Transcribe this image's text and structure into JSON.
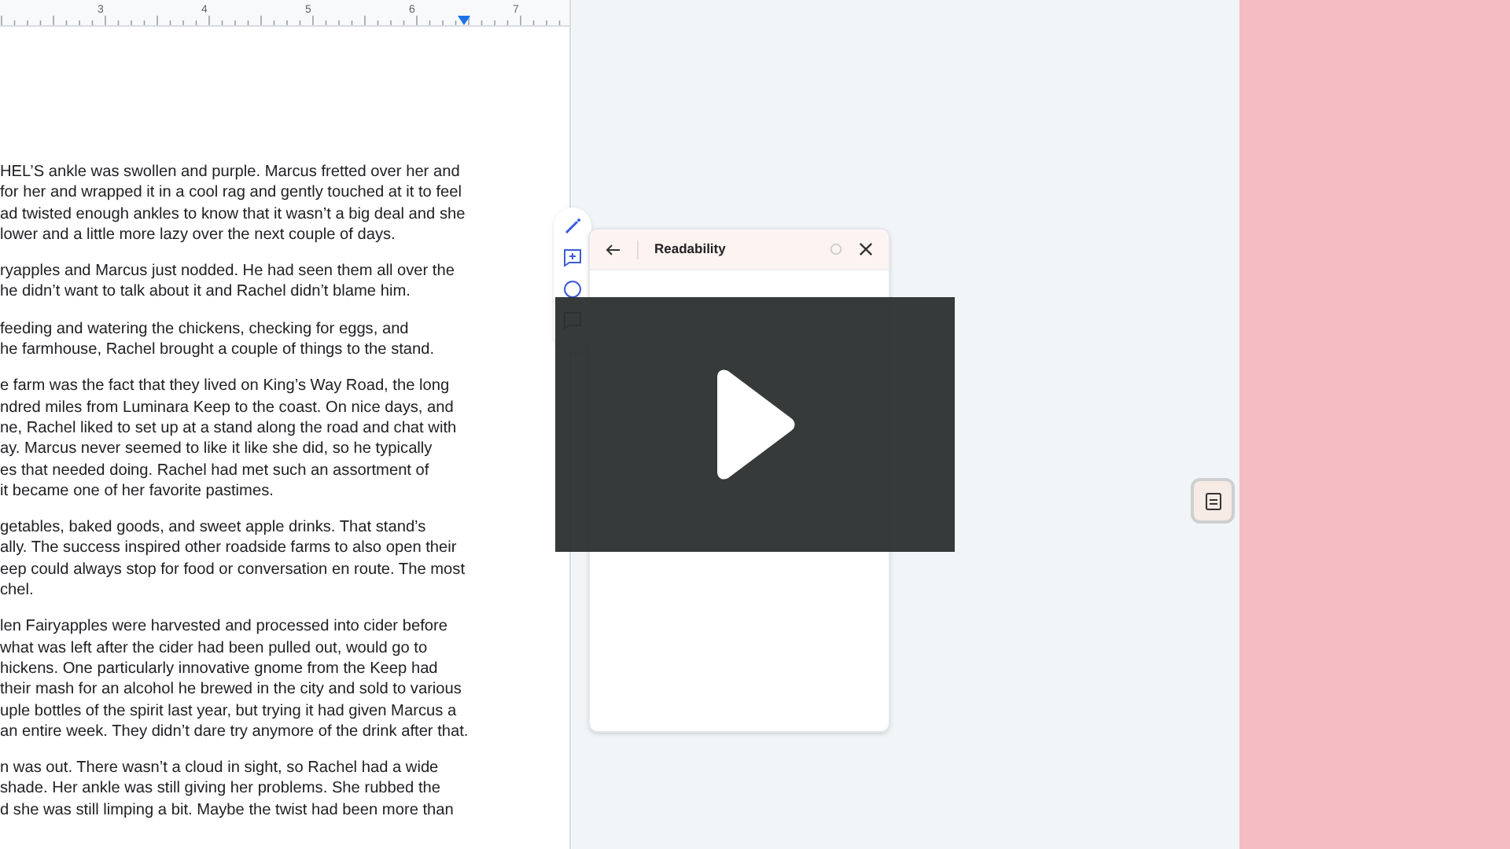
{
  "ruler": {
    "numbers": [
      "3",
      "4",
      "5",
      "6",
      "7"
    ]
  },
  "document": {
    "paragraphs": [
      {
        "lines": [
          "HEL’S ankle was swollen and purple. Marcus fretted over her and",
          "for her and wrapped it in a cool rag and gently touched at it to feel",
          "ad twisted enough ankles to know that it wasn’t a big deal and she",
          "lower and a little more lazy over the next couple of days."
        ]
      },
      {
        "lines": [
          "ryapples and Marcus just nodded. He had seen them all over the",
          "he didn’t want to talk about it and Rachel didn’t blame him."
        ]
      },
      {
        "lines": [
          "feeding and watering the chickens, checking for eggs, and",
          "he farmhouse, Rachel brought a couple of things to the stand."
        ]
      },
      {
        "lines": [
          "e farm was the fact that they lived on King’s Way Road, the long",
          "ndred miles from Luminara Keep to the coast. On nice days, and",
          "ne, Rachel liked to set up at a stand along the road and chat with",
          "ay. Marcus never seemed to like it like she did, so he typically",
          "es that needed doing. Rachel had met such an assortment of",
          "it became one of her favorite pastimes."
        ]
      },
      {
        "lines": [
          "getables, baked goods, and sweet apple drinks. That stand’s",
          "ally. The success inspired other roadside farms to also open their",
          "eep could always stop for food or conversation en route. The most",
          "chel."
        ]
      },
      {
        "lines": [
          "len Fairyapples were harvested and processed into cider before",
          "what was left after the cider had been pulled out, would go to",
          "hickens. One particularly innovative gnome from the Keep had",
          "their mash for an alcohol he brewed in the city and sold to various",
          "uple bottles of the spirit last year, but trying it had given Marcus a",
          "an entire week. They didn’t dare try anymore of the drink after that."
        ]
      },
      {
        "lines": [
          "n was out. There wasn’t a cloud in sight, so Rachel had a wide",
          "shade. Her ankle was still giving her problems. She rubbed the",
          "d she was still limping a bit. Maybe the twist had been more than"
        ]
      }
    ]
  },
  "panel": {
    "title": "Readability"
  }
}
